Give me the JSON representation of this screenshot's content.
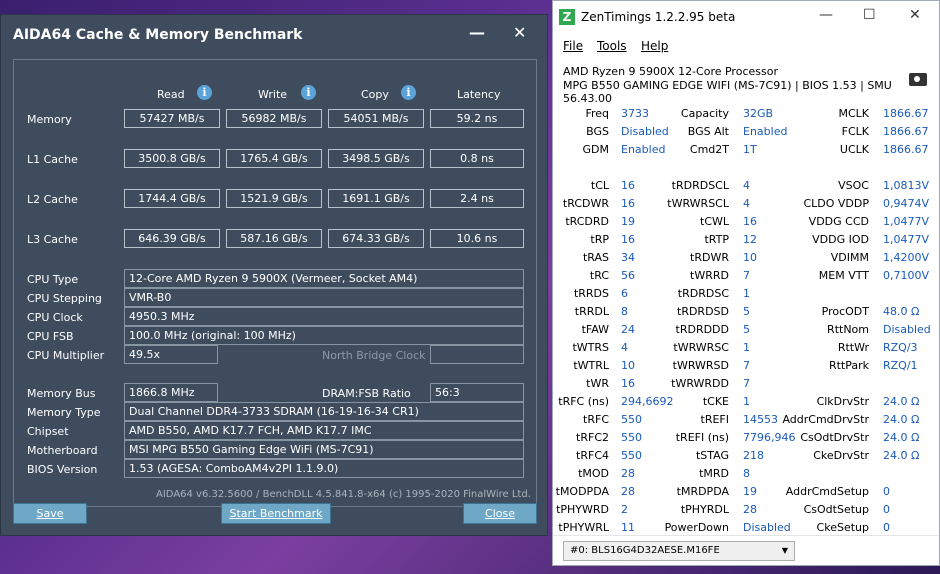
{
  "aida": {
    "title": "AIDA64 Cache & Memory Benchmark",
    "headers": [
      "Read",
      "Write",
      "Copy",
      "Latency"
    ],
    "bench_rows": [
      {
        "label": "Memory",
        "values": [
          "57427 MB/s",
          "56982 MB/s",
          "54051 MB/s",
          "59.2 ns"
        ]
      },
      {
        "label": "L1 Cache",
        "values": [
          "3500.8 GB/s",
          "1765.4 GB/s",
          "3498.5 GB/s",
          "0.8 ns"
        ]
      },
      {
        "label": "L2 Cache",
        "values": [
          "1744.4 GB/s",
          "1521.9 GB/s",
          "1691.1 GB/s",
          "2.4 ns"
        ]
      },
      {
        "label": "L3 Cache",
        "values": [
          "646.39 GB/s",
          "587.16 GB/s",
          "674.33 GB/s",
          "10.6 ns"
        ]
      }
    ],
    "cpu": {
      "type_label": "CPU Type",
      "type": "12-Core AMD Ryzen 9 5900X  (Vermeer, Socket AM4)",
      "stepping_label": "CPU Stepping",
      "stepping": "VMR-B0",
      "clock_label": "CPU Clock",
      "clock": "4950.3 MHz",
      "fsb_label": "CPU FSB",
      "fsb": "100.0 MHz  (original: 100 MHz)",
      "mult_label": "CPU Multiplier",
      "mult": "49.5x",
      "nb_label": "North Bridge Clock"
    },
    "mem": {
      "bus_label": "Memory Bus",
      "bus": "1866.8 MHz",
      "ratio_label": "DRAM:FSB Ratio",
      "ratio": "56:3",
      "type_label": "Memory Type",
      "type": "Dual Channel DDR4-3733 SDRAM  (16-19-16-34 CR1)",
      "chipset_label": "Chipset",
      "chipset": "AMD B550, AMD K17.7 FCH, AMD K17.7 IMC",
      "mobo_label": "Motherboard",
      "mobo": "MSI MPG B550 Gaming Edge WiFi (MS-7C91)",
      "bios_label": "BIOS Version",
      "bios": "1.53  (AGESA: ComboAM4v2PI 1.1.9.0)"
    },
    "footer": "AIDA64 v6.32.5600 / BenchDLL 4.5.841.8-x64  (c) 1995-2020 FinalWire Ltd.",
    "buttons": {
      "save": "Save",
      "start": "Start Benchmark",
      "close": "Close"
    }
  },
  "zen": {
    "title": "ZenTimings 1.2.2.95 beta",
    "logo": "Z",
    "menu": [
      "File",
      "Tools",
      "Help"
    ],
    "cpu_line": "AMD Ryzen 9 5900X 12-Core Processor",
    "board_line": "MPG B550 GAMING EDGE WIFI (MS-7C91) | BIOS 1.53 | SMU 56.43.00",
    "col1": [
      [
        "Freq",
        "3733"
      ],
      [
        "BGS",
        "Disabled"
      ],
      [
        "GDM",
        "Enabled"
      ],
      [
        "",
        ""
      ],
      [
        "tCL",
        "16"
      ],
      [
        "tRCDWR",
        "16"
      ],
      [
        "tRCDRD",
        "19"
      ],
      [
        "tRP",
        "16"
      ],
      [
        "tRAS",
        "34"
      ],
      [
        "tRC",
        "56"
      ],
      [
        "tRRDS",
        "6"
      ],
      [
        "tRRDL",
        "8"
      ],
      [
        "tFAW",
        "24"
      ],
      [
        "tWTRS",
        "4"
      ],
      [
        "tWTRL",
        "10"
      ],
      [
        "tWR",
        "16"
      ],
      [
        "tRFC (ns)",
        "294,6692"
      ],
      [
        "tRFC",
        "550"
      ],
      [
        "tRFC2",
        "550"
      ],
      [
        "tRFC4",
        "550"
      ],
      [
        "tMOD",
        "28"
      ],
      [
        "tMODPDA",
        "28"
      ],
      [
        "tPHYWRD",
        "2"
      ],
      [
        "tPHYWRL",
        "11"
      ]
    ],
    "col2": [
      [
        "Capacity",
        "32GB"
      ],
      [
        "BGS Alt",
        "Enabled"
      ],
      [
        "Cmd2T",
        "1T"
      ],
      [
        "",
        ""
      ],
      [
        "tRDRDSCL",
        "4"
      ],
      [
        "tWRWRSCL",
        "4"
      ],
      [
        "tCWL",
        "16"
      ],
      [
        "tRTP",
        "12"
      ],
      [
        "tRDWR",
        "10"
      ],
      [
        "tWRRD",
        "7"
      ],
      [
        "tRDRDSC",
        "1"
      ],
      [
        "tRDRDSD",
        "5"
      ],
      [
        "tRDRDDD",
        "5"
      ],
      [
        "tWRWRSC",
        "1"
      ],
      [
        "tWRWRSD",
        "7"
      ],
      [
        "tWRWRDD",
        "7"
      ],
      [
        "tCKE",
        "1"
      ],
      [
        "tREFI",
        "14553"
      ],
      [
        "tREFI (ns)",
        "7796,946"
      ],
      [
        "tSTAG",
        "218"
      ],
      [
        "tMRD",
        "8"
      ],
      [
        "tMRDPDA",
        "19"
      ],
      [
        "tPHYRDL",
        "28"
      ],
      [
        "PowerDown",
        "Disabled"
      ]
    ],
    "col3": [
      [
        "MCLK",
        "1866.67"
      ],
      [
        "FCLK",
        "1866.67"
      ],
      [
        "UCLK",
        "1866.67"
      ],
      [
        "",
        ""
      ],
      [
        "VSOC",
        "1,0813V"
      ],
      [
        "CLDO VDDP",
        "0,9474V"
      ],
      [
        "VDDG CCD",
        "1,0477V"
      ],
      [
        "VDDG IOD",
        "1,0477V"
      ],
      [
        "VDIMM",
        "1,4200V"
      ],
      [
        "MEM VTT",
        "0,7100V"
      ],
      [
        "",
        ""
      ],
      [
        "ProcODT",
        "48.0 Ω"
      ],
      [
        "RttNom",
        "Disabled"
      ],
      [
        "RttWr",
        "RZQ/3"
      ],
      [
        "RttPark",
        "RZQ/1"
      ],
      [
        "",
        ""
      ],
      [
        "ClkDrvStr",
        "24.0 Ω"
      ],
      [
        "AddrCmdDrvStr",
        "24.0 Ω"
      ],
      [
        "CsOdtDrvStr",
        "24.0 Ω"
      ],
      [
        "CkeDrvStr",
        "24.0 Ω"
      ],
      [
        "",
        ""
      ],
      [
        "AddrCmdSetup",
        "0"
      ],
      [
        "CsOdtSetup",
        "0"
      ],
      [
        "CkeSetup",
        "0"
      ]
    ],
    "module": "#0: BLS16G4D32AESE.M16FE"
  }
}
